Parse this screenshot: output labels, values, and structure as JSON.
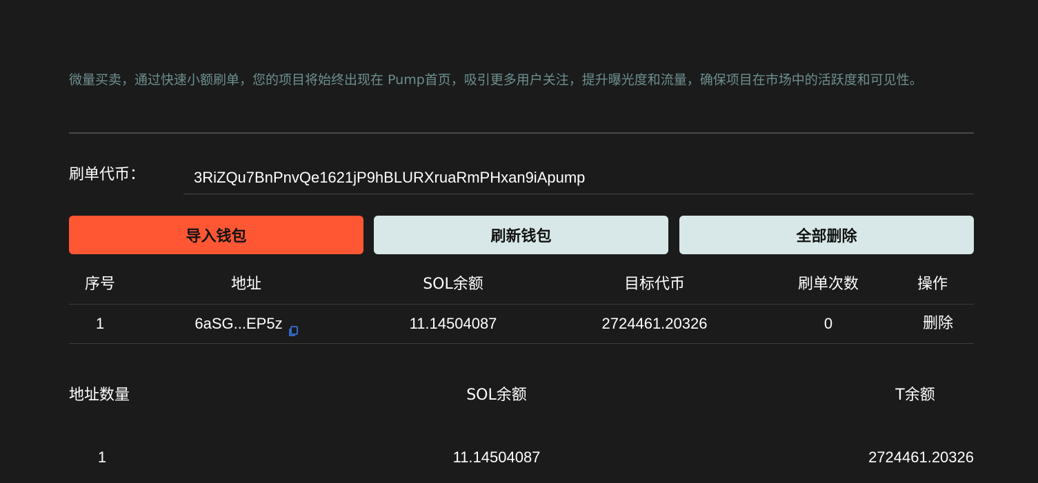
{
  "description": "微量买卖，通过快速小额刷单，您的项目将始终出现在 Pump首页，吸引更多用户关注，提升曝光度和流量，确保项目在市场中的活跃度和可见性。",
  "token": {
    "label": "刷单代币：",
    "value": "3RiZQu7BnPnvQe1621jP9hBLURXruaRmPHxan9iApump"
  },
  "buttons": {
    "import": "导入钱包",
    "refresh": "刷新钱包",
    "delete_all": "全部删除"
  },
  "colors": {
    "primary": "#ff5733",
    "secondary": "#d8e8e8",
    "description_text": "#6e8e8e",
    "copy_icon": "#3b7ff5"
  },
  "table": {
    "headers": [
      "序号",
      "地址",
      "SOL余额",
      "目标代币",
      "刷单次数",
      "操作"
    ],
    "rows": [
      {
        "index": "1",
        "address": "6aSG...EP5z",
        "copy_icon": "copy-icon",
        "sol": "11.14504087",
        "target": "2724461.20326",
        "count": "0",
        "action": "删除"
      }
    ]
  },
  "summary": {
    "headers": [
      "地址数量",
      "SOL余额",
      "T余额"
    ],
    "values": [
      "1",
      "11.14504087",
      "2724461.20326"
    ]
  }
}
